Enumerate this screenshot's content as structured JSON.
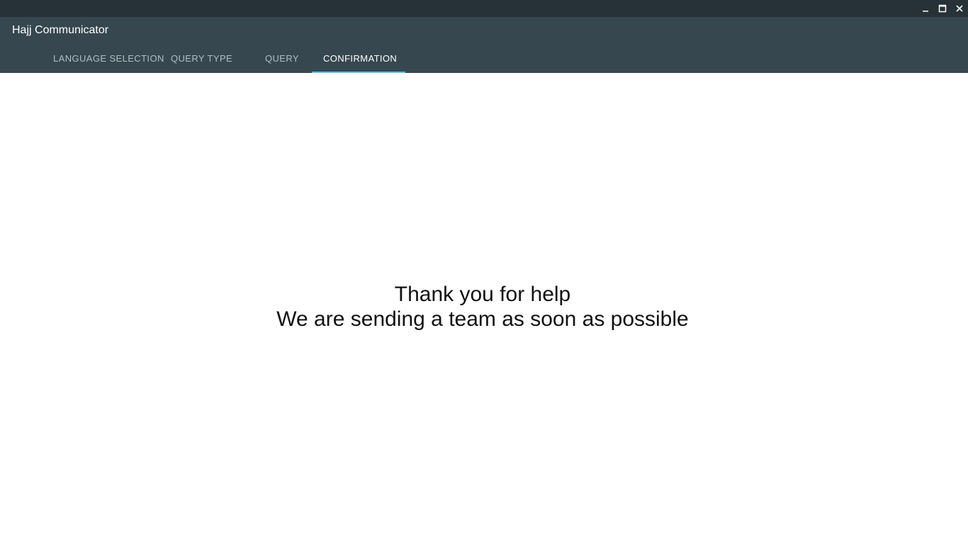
{
  "window": {
    "controls": [
      {
        "name": "minimize-icon"
      },
      {
        "name": "maximize-icon"
      },
      {
        "name": "close-icon"
      }
    ]
  },
  "app": {
    "title": "Hajj Communicator"
  },
  "tabs": [
    {
      "label": "LANGUAGE SELECTION",
      "active": false
    },
    {
      "label": "QUERY TYPE",
      "active": false
    },
    {
      "label": "QUERY",
      "active": false
    },
    {
      "label": "CONFIRMATION",
      "active": true
    }
  ],
  "confirmation": {
    "line1": "Thank you for help",
    "line2": "We are sending a team as soon as possible"
  },
  "colors": {
    "titlebar": "#263238",
    "appbar": "#37474f",
    "tab_indicator": "#4fc3f7",
    "tab_inactive": "#b0bec5",
    "tab_active": "#ffffff"
  }
}
